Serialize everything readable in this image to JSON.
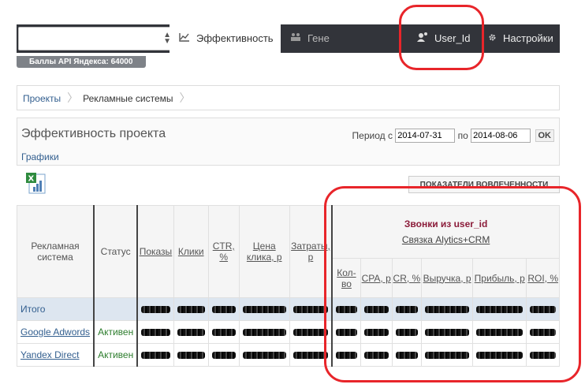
{
  "nav": {
    "tabs": [
      {
        "label": "Эффективность",
        "icon": "chart-line-icon"
      },
      {
        "label": "Гене",
        "icon": "people-icon"
      },
      {
        "label": "User_Id",
        "icon": "user-icon"
      },
      {
        "label": "Настройки",
        "icon": "gear-icon"
      }
    ],
    "api_badge": "Баллы API Яндекса: 64000"
  },
  "breadcrumb": [
    "Проекты",
    "Рекламные системы"
  ],
  "panel": {
    "title": "Эффективность проекта",
    "link": "Графики",
    "period_label": "Период с",
    "date_from": "2014-07-31",
    "to_label": "по",
    "date_to": "2014-08-06",
    "ok": "OK"
  },
  "engagement_button": "ПОКАЗАТЕЛИ ВОВЛЕЧЕННОСТИ",
  "table": {
    "headers": {
      "system": "Рекламная система",
      "status": "Статус",
      "impressions": "Показы",
      "clicks": "Клики",
      "ctr": "CTR, %",
      "cpc": "Цена клика, р",
      "cost": "Затраты, р",
      "group_title": "Звонки из user_id",
      "group_sub": "Связка Alytics+CRM",
      "calls_count": "Кол-во",
      "cpa": "CPA, р",
      "cr": "CR, %",
      "revenue": "Выручка, р",
      "profit": "Прибыль, р",
      "roi": "ROI, %"
    },
    "rows": [
      {
        "system": "Итого",
        "status": ""
      },
      {
        "system": "Google Adwords",
        "status": "Активен"
      },
      {
        "system": "Yandex Direct",
        "status": "Активен"
      }
    ]
  }
}
